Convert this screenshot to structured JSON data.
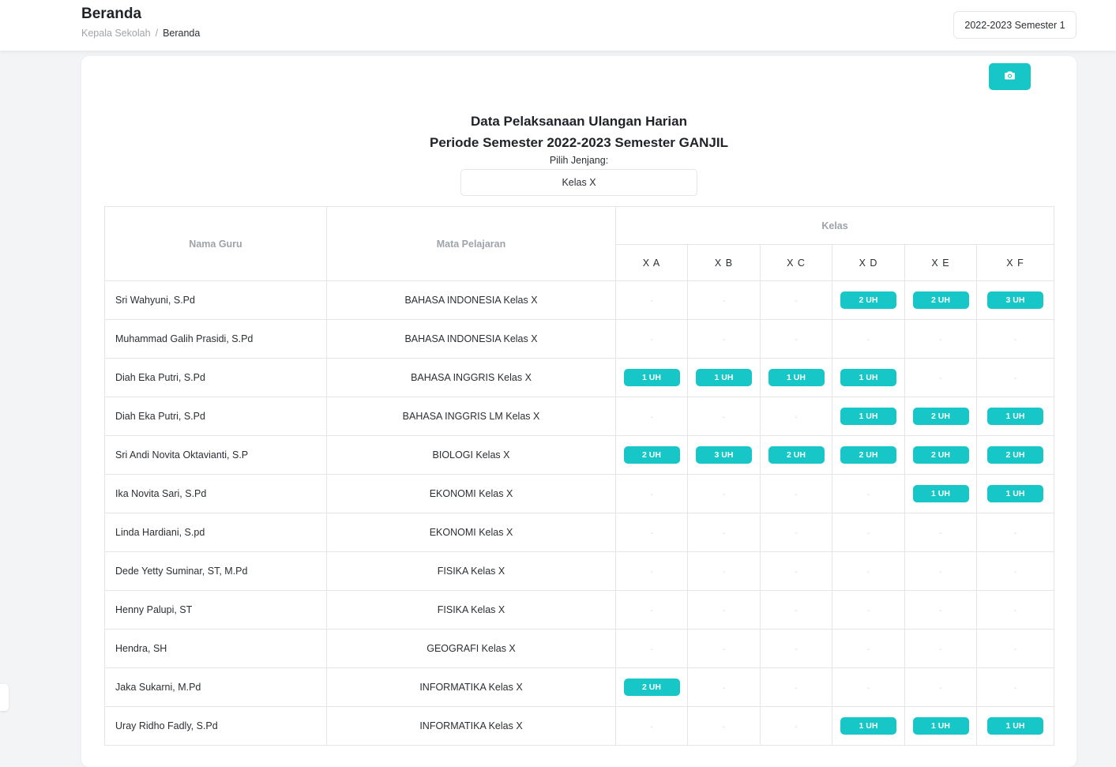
{
  "header": {
    "title": "Beranda",
    "breadcrumb": {
      "parent": "Kepala Sekolah",
      "separator": "/",
      "current": "Beranda"
    },
    "semester_button": "2022-2023 Semester 1"
  },
  "card": {
    "camera_icon": "camera-icon",
    "heading_line1": "Data Pelaksanaan Ulangan Harian",
    "heading_line2": "Periode Semester 2022-2023 Semester GANJIL",
    "jenjang_label": "Pilih Jenjang:",
    "jenjang_value": "Kelas X"
  },
  "table": {
    "headers": {
      "guru": "Nama Guru",
      "mapel": "Mata Pelajaran",
      "kelas": "Kelas"
    },
    "classes": [
      "X A",
      "X B",
      "X C",
      "X D",
      "X E",
      "X F"
    ],
    "empty_marker": "-",
    "rows": [
      {
        "guru": "Sri Wahyuni, S.Pd",
        "mapel": "BAHASA INDONESIA Kelas X",
        "cells": [
          "-",
          "-",
          "-",
          "2 UH",
          "2 UH",
          "3 UH"
        ]
      },
      {
        "guru": "Muhammad Galih Prasidi, S.Pd",
        "mapel": "BAHASA INDONESIA Kelas X",
        "cells": [
          "-",
          "-",
          "-",
          "-",
          "-",
          "-"
        ]
      },
      {
        "guru": "Diah Eka Putri, S.Pd",
        "mapel": "BAHASA INGGRIS Kelas X",
        "cells": [
          "1 UH",
          "1 UH",
          "1 UH",
          "1 UH",
          "-",
          "-"
        ]
      },
      {
        "guru": "Diah Eka Putri, S.Pd",
        "mapel": "BAHASA INGGRIS LM Kelas X",
        "cells": [
          "-",
          "-",
          "-",
          "1 UH",
          "2 UH",
          "1 UH"
        ]
      },
      {
        "guru": "Sri Andi Novita Oktavianti, S.P",
        "mapel": "BIOLOGI Kelas X",
        "cells": [
          "2 UH",
          "3 UH",
          "2 UH",
          "2 UH",
          "2 UH",
          "2 UH"
        ]
      },
      {
        "guru": "Ika Novita Sari, S.Pd",
        "mapel": "EKONOMI Kelas X",
        "cells": [
          "-",
          "-",
          "-",
          "-",
          "1 UH",
          "1 UH"
        ]
      },
      {
        "guru": "Linda Hardiani, S.pd",
        "mapel": "EKONOMI Kelas X",
        "cells": [
          "-",
          "-",
          "-",
          "-",
          "-",
          "-"
        ]
      },
      {
        "guru": "Dede Yetty Suminar, ST, M.Pd",
        "mapel": "FISIKA Kelas X",
        "cells": [
          "-",
          "-",
          "-",
          "-",
          "-",
          "-"
        ]
      },
      {
        "guru": "Henny Palupi, ST",
        "mapel": "FISIKA Kelas X",
        "cells": [
          "-",
          "-",
          "-",
          "-",
          "-",
          "-"
        ]
      },
      {
        "guru": "Hendra, SH",
        "mapel": "GEOGRAFI Kelas X",
        "cells": [
          "-",
          "-",
          "-",
          "-",
          "-",
          "-"
        ]
      },
      {
        "guru": "Jaka Sukarni, M.Pd",
        "mapel": "INFORMATIKA Kelas X",
        "cells": [
          "2 UH",
          "-",
          "-",
          "-",
          "-",
          "-"
        ]
      },
      {
        "guru": "Uray Ridho Fadly, S.Pd",
        "mapel": "INFORMATIKA Kelas X",
        "cells": [
          "-",
          "-",
          "-",
          "1 UH",
          "1 UH",
          "1 UH"
        ]
      }
    ]
  },
  "colors": {
    "accent": "#17c6c6",
    "header_text": "#9ea3aa",
    "border": "#e3e5e8"
  }
}
